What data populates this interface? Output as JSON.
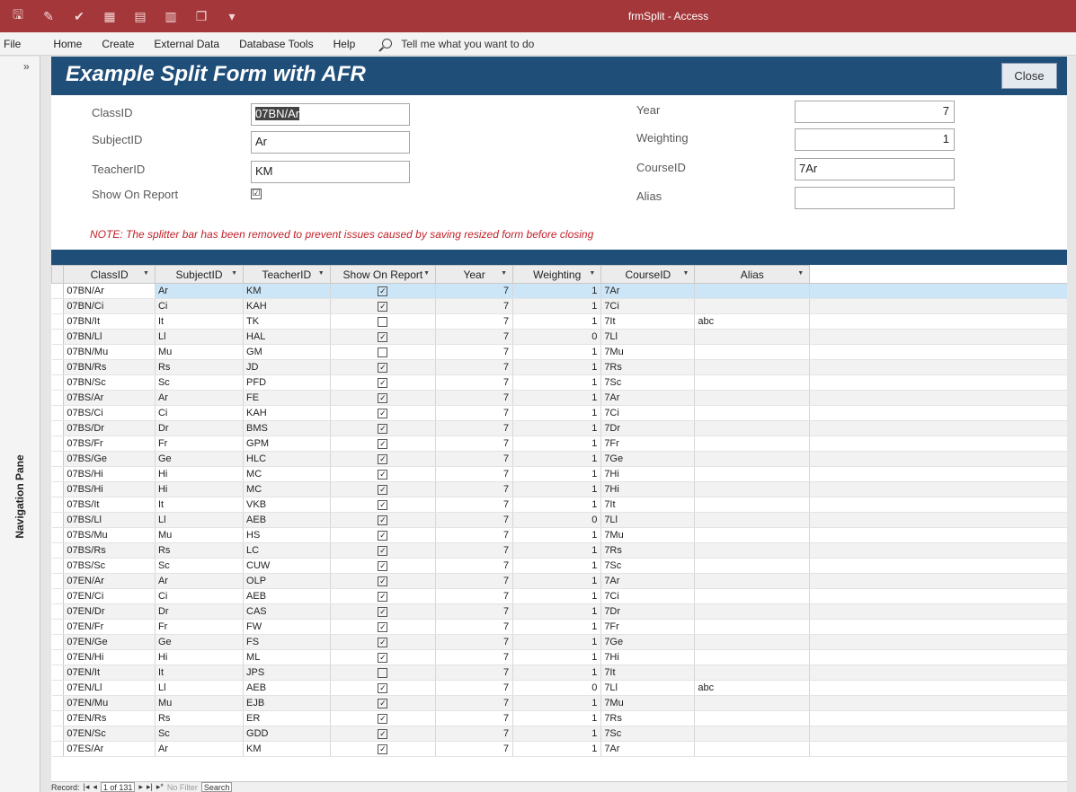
{
  "window": {
    "title": "frmSplit - Access"
  },
  "qat_icons": [
    "save-icon",
    "touch-mode-icon",
    "undo-icon",
    "form-icon",
    "report-icon",
    "table-icon",
    "copy-icon",
    "customize-icon"
  ],
  "qat_glyphs": [
    "🖫",
    "✎",
    "✔",
    "▦",
    "▤",
    "▥",
    "❐",
    "▾"
  ],
  "menu": {
    "file": "File",
    "home": "Home",
    "create": "Create",
    "external": "External Data",
    "dbtools": "Database Tools",
    "help": "Help",
    "tellme": "Tell me what you want to do"
  },
  "nav": {
    "chevron": "»",
    "label": "Navigation Pane"
  },
  "form": {
    "title": "Example Split Form with AFR",
    "close": "Close",
    "labels": {
      "classid": "ClassID",
      "subjectid": "SubjectID",
      "teacherid": "TeacherID",
      "show": "Show On Report",
      "year": "Year",
      "weighting": "Weighting",
      "courseid": "CourseID",
      "alias": "Alias"
    },
    "values": {
      "classid": "07BN/Ar",
      "subjectid": "Ar",
      "teacherid": "KM",
      "show": "☑",
      "year": "7",
      "weighting": "1",
      "courseid": "7Ar",
      "alias": ""
    },
    "note": "NOTE: The splitter bar has been removed to prevent issues caused by saving resized form before closing"
  },
  "columns": [
    "ClassID",
    "SubjectID",
    "TeacherID",
    "Show On Report",
    "Year",
    "Weighting",
    "CourseID",
    "Alias"
  ],
  "rows": [
    [
      "07BN/Ar",
      "Ar",
      "KM",
      true,
      "7",
      "1",
      "7Ar",
      ""
    ],
    [
      "07BN/Ci",
      "Ci",
      "KAH",
      true,
      "7",
      "1",
      "7Ci",
      ""
    ],
    [
      "07BN/It",
      "It",
      "TK",
      false,
      "7",
      "1",
      "7It",
      "abc"
    ],
    [
      "07BN/Ll",
      "Ll",
      "HAL",
      true,
      "7",
      "0",
      "7Ll",
      ""
    ],
    [
      "07BN/Mu",
      "Mu",
      "GM",
      false,
      "7",
      "1",
      "7Mu",
      ""
    ],
    [
      "07BN/Rs",
      "Rs",
      "JD",
      true,
      "7",
      "1",
      "7Rs",
      ""
    ],
    [
      "07BN/Sc",
      "Sc",
      "PFD",
      true,
      "7",
      "1",
      "7Sc",
      ""
    ],
    [
      "07BS/Ar",
      "Ar",
      "FE",
      true,
      "7",
      "1",
      "7Ar",
      ""
    ],
    [
      "07BS/Ci",
      "Ci",
      "KAH",
      true,
      "7",
      "1",
      "7Ci",
      ""
    ],
    [
      "07BS/Dr",
      "Dr",
      "BMS",
      true,
      "7",
      "1",
      "7Dr",
      ""
    ],
    [
      "07BS/Fr",
      "Fr",
      "GPM",
      true,
      "7",
      "1",
      "7Fr",
      ""
    ],
    [
      "07BS/Ge",
      "Ge",
      "HLC",
      true,
      "7",
      "1",
      "7Ge",
      ""
    ],
    [
      "07BS/Hi",
      "Hi",
      "MC",
      true,
      "7",
      "1",
      "7Hi",
      ""
    ],
    [
      "07BS/Hi",
      "Hi",
      "MC",
      true,
      "7",
      "1",
      "7Hi",
      ""
    ],
    [
      "07BS/It",
      "It",
      "VKB",
      true,
      "7",
      "1",
      "7It",
      ""
    ],
    [
      "07BS/Ll",
      "Ll",
      "AEB",
      true,
      "7",
      "0",
      "7Ll",
      ""
    ],
    [
      "07BS/Mu",
      "Mu",
      "HS",
      true,
      "7",
      "1",
      "7Mu",
      ""
    ],
    [
      "07BS/Rs",
      "Rs",
      "LC",
      true,
      "7",
      "1",
      "7Rs",
      ""
    ],
    [
      "07BS/Sc",
      "Sc",
      "CUW",
      true,
      "7",
      "1",
      "7Sc",
      ""
    ],
    [
      "07EN/Ar",
      "Ar",
      "OLP",
      true,
      "7",
      "1",
      "7Ar",
      ""
    ],
    [
      "07EN/Ci",
      "Ci",
      "AEB",
      true,
      "7",
      "1",
      "7Ci",
      ""
    ],
    [
      "07EN/Dr",
      "Dr",
      "CAS",
      true,
      "7",
      "1",
      "7Dr",
      ""
    ],
    [
      "07EN/Fr",
      "Fr",
      "FW",
      true,
      "7",
      "1",
      "7Fr",
      ""
    ],
    [
      "07EN/Ge",
      "Ge",
      "FS",
      true,
      "7",
      "1",
      "7Ge",
      ""
    ],
    [
      "07EN/Hi",
      "Hi",
      "ML",
      true,
      "7",
      "1",
      "7Hi",
      ""
    ],
    [
      "07EN/It",
      "It",
      "JPS",
      false,
      "7",
      "1",
      "7It",
      ""
    ],
    [
      "07EN/Ll",
      "Ll",
      "AEB",
      true,
      "7",
      "0",
      "7Ll",
      "abc"
    ],
    [
      "07EN/Mu",
      "Mu",
      "EJB",
      true,
      "7",
      "1",
      "7Mu",
      ""
    ],
    [
      "07EN/Rs",
      "Rs",
      "ER",
      true,
      "7",
      "1",
      "7Rs",
      ""
    ],
    [
      "07EN/Sc",
      "Sc",
      "GDD",
      true,
      "7",
      "1",
      "7Sc",
      ""
    ],
    [
      "07ES/Ar",
      "Ar",
      "KM",
      true,
      "7",
      "1",
      "7Ar",
      ""
    ]
  ],
  "recnav": {
    "label": "Record:",
    "first": "|◂",
    "prev": "◂",
    "position": "1 of 131",
    "next": "▸",
    "last": "▸|",
    "new": "▸*",
    "filter": "No Filter",
    "search": "Search"
  },
  "colors": {
    "titlebar": "#a4373a",
    "header": "#1f4e79",
    "note": "#c0222a",
    "current_row": "#cde6f7"
  }
}
